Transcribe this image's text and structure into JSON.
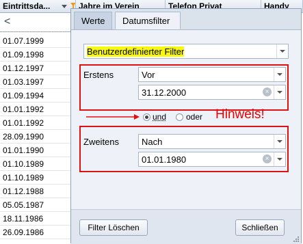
{
  "grid": {
    "columns": [
      {
        "label": "Eintrittsda..."
      },
      {
        "label": "Jahre im Verein"
      },
      {
        "label": "Telefon Privat"
      },
      {
        "label": "Handy"
      }
    ],
    "nav_back": "<",
    "rows": [
      "01.07.1999",
      "01.09.1998",
      "01.12.1997",
      "01.03.1997",
      "01.09.1994",
      "01.01.1992",
      "01.01.1992",
      "28.09.1990",
      "01.01.1990",
      "01.10.1989",
      "01.10.1989",
      "01.12.1988",
      "05.05.1987",
      "18.11.1986",
      "26.09.1986"
    ]
  },
  "popup": {
    "tabs": [
      {
        "label": "Werte"
      },
      {
        "label": "Datumsfilter"
      }
    ],
    "active_tab": "Datumsfilter",
    "filter_type": "Benutzerdefinierter Filter",
    "first": {
      "label": "Erstens",
      "operator": "Vor",
      "date": "31.12.2000"
    },
    "logic": {
      "and_label": "und",
      "or_label": "oder",
      "selected": "und"
    },
    "hint": "Hinweis!",
    "second": {
      "label": "Zweitens",
      "operator": "Nach",
      "date": "01.01.1980"
    },
    "buttons": {
      "clear": "Filter Löschen",
      "close": "Schließen"
    }
  },
  "colors": {
    "highlight": "#f8f80f",
    "annotation": "#dd1111"
  }
}
